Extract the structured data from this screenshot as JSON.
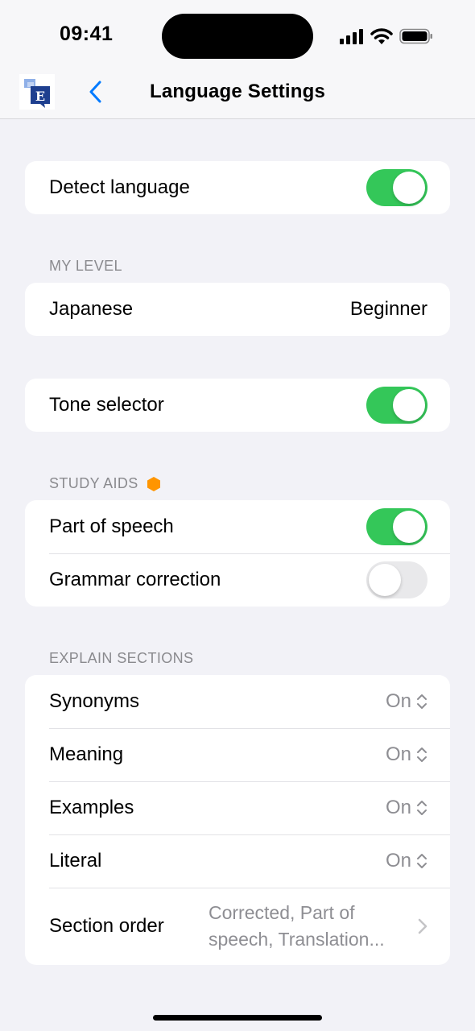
{
  "status_bar": {
    "time": "09:41"
  },
  "nav": {
    "title": "Language Settings",
    "logo_letter": "E"
  },
  "detect": {
    "label": "Detect language",
    "on": true
  },
  "my_level": {
    "header": "MY LEVEL",
    "language": "Japanese",
    "level": "Beginner"
  },
  "tone": {
    "label": "Tone selector",
    "on": true
  },
  "study_aids": {
    "header": "STUDY AIDS",
    "badge_color": "#ff9500",
    "part_of_speech": {
      "label": "Part of speech",
      "on": true
    },
    "grammar": {
      "label": "Grammar correction",
      "on": false
    }
  },
  "explain": {
    "header": "EXPLAIN SECTIONS",
    "synonyms": {
      "label": "Synonyms",
      "value": "On"
    },
    "meaning": {
      "label": "Meaning",
      "value": "On"
    },
    "examples": {
      "label": "Examples",
      "value": "On"
    },
    "literal": {
      "label": "Literal",
      "value": "On"
    },
    "order": {
      "label": "Section order",
      "value": "Corrected, Part of speech, Translation..."
    }
  },
  "colors": {
    "accent": "#007aff",
    "toggle_on": "#34c759",
    "background": "#f2f2f7"
  }
}
